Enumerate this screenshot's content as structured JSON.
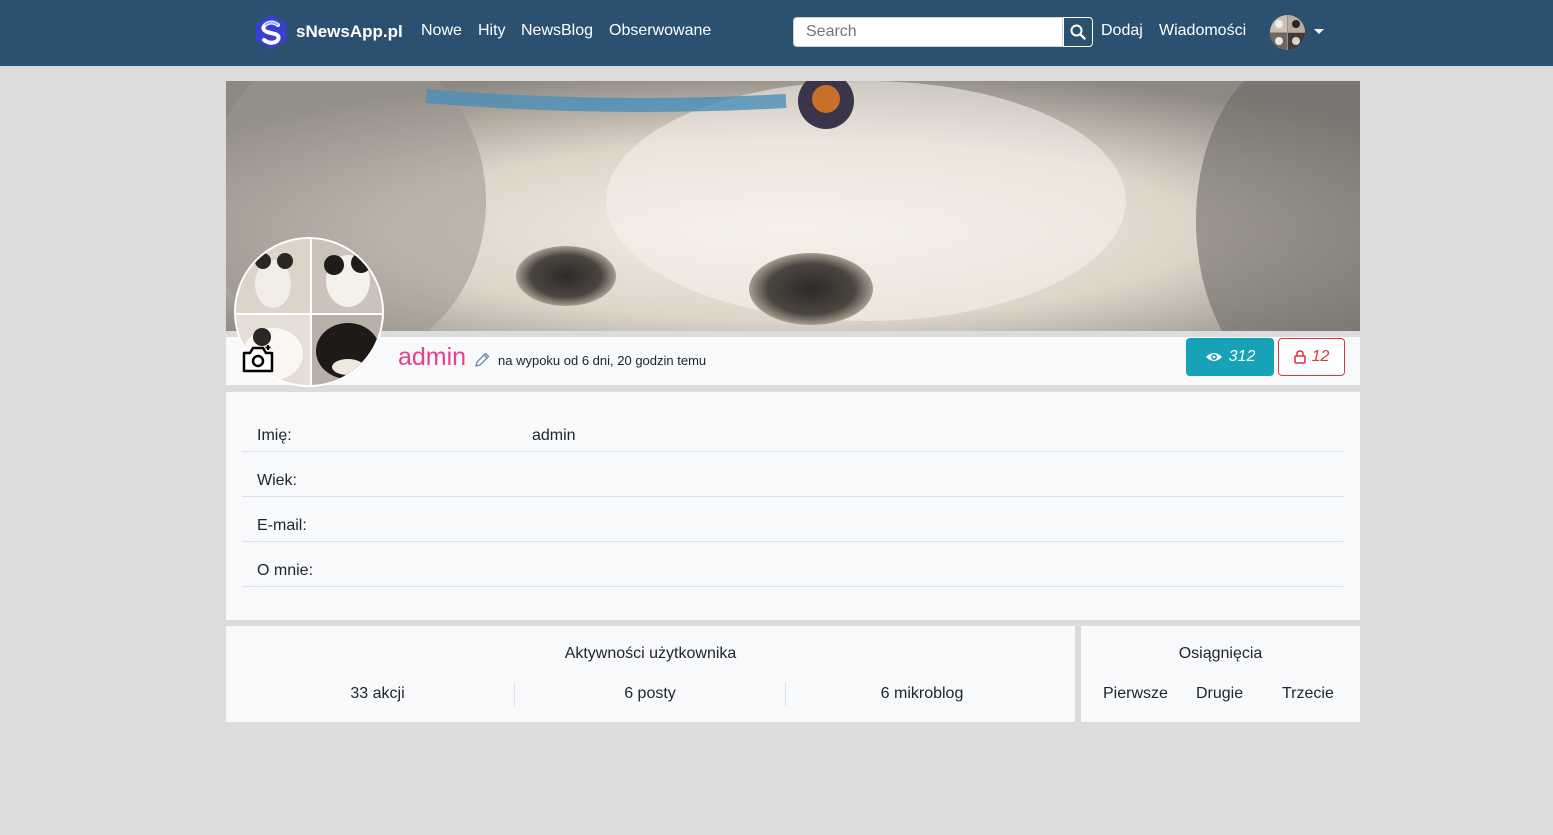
{
  "navbar": {
    "brand": "sNewsApp.pl",
    "links": [
      "Nowe",
      "Hity",
      "NewsBlog",
      "Obserwowane"
    ],
    "search_placeholder": "Search",
    "right_links": [
      "Dodaj",
      "Wiadomości"
    ],
    "color": "#2b5070"
  },
  "profile": {
    "username": "admin",
    "joined": "na wypoku od 6 dni, 20 godzin temu",
    "views": "312",
    "locks": "12",
    "username_color": "#e83e8c"
  },
  "info": {
    "rows": [
      {
        "label": "Imię:",
        "value": "admin"
      },
      {
        "label": "Wiek:",
        "value": ""
      },
      {
        "label": "E-mail:",
        "value": ""
      },
      {
        "label": "O mnie:",
        "value": ""
      }
    ]
  },
  "activity": {
    "title": "Aktywności użytkownika",
    "stats": [
      "33 akcji",
      "6 posty",
      "6 mikroblog"
    ]
  },
  "achievements": {
    "title": "Osiągnięcia",
    "items": [
      "Pierwsze",
      "Drugie",
      "Trzecie"
    ]
  }
}
